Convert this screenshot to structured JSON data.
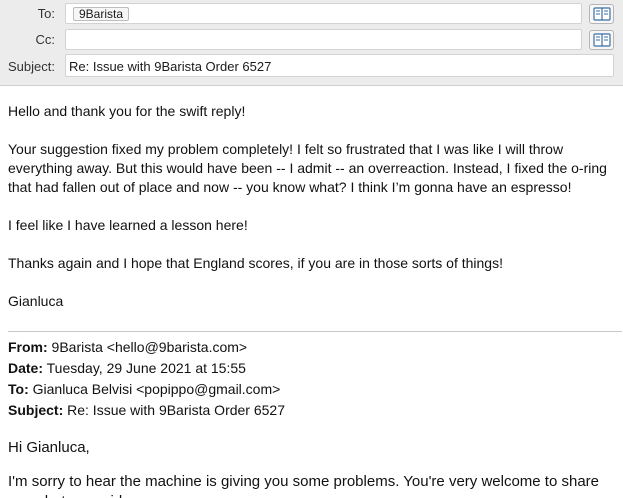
{
  "header": {
    "to_label": "To:",
    "to_recipient": "9Barista",
    "cc_label": "Cc:",
    "cc_value": "",
    "subject_label": "Subject:",
    "subject_value": "Re: Issue with 9Barista Order 6527"
  },
  "message": {
    "greeting": "Hello and thank you for the swift reply!",
    "paragraph_1": "Your suggestion fixed my problem completely! I felt so frustrated that I was like I will throw everything away. But this would have been -- I admit -- an overreaction. Instead, I fixed the o-ring that had fallen out of place and now -- you know what? I think I’m gonna have an espresso!",
    "paragraph_2": "I feel like I have learned a lesson here!",
    "paragraph_3": "Thanks again and I hope that England scores, if you are in those sorts of things!",
    "signature": "Gianluca"
  },
  "quoted": {
    "from_label": "From:",
    "from_value": " 9Barista <hello@9barista.com>",
    "date_label": "Date:",
    "date_value": " Tuesday, 29 June 2021 at 15:55",
    "to_label": "To:",
    "to_value": " Gianluca Belvisi <popippo@gmail.com>",
    "subject_label": "Subject:",
    "subject_value": " Re: Issue with 9Barista Order 6527",
    "reply_greeting": "Hi Gianluca,",
    "reply_text": "I'm sorry to hear the machine is giving you some problems. You're very welcome to share any photos or videos"
  },
  "icons": {
    "address_book": "address-book-icon"
  }
}
